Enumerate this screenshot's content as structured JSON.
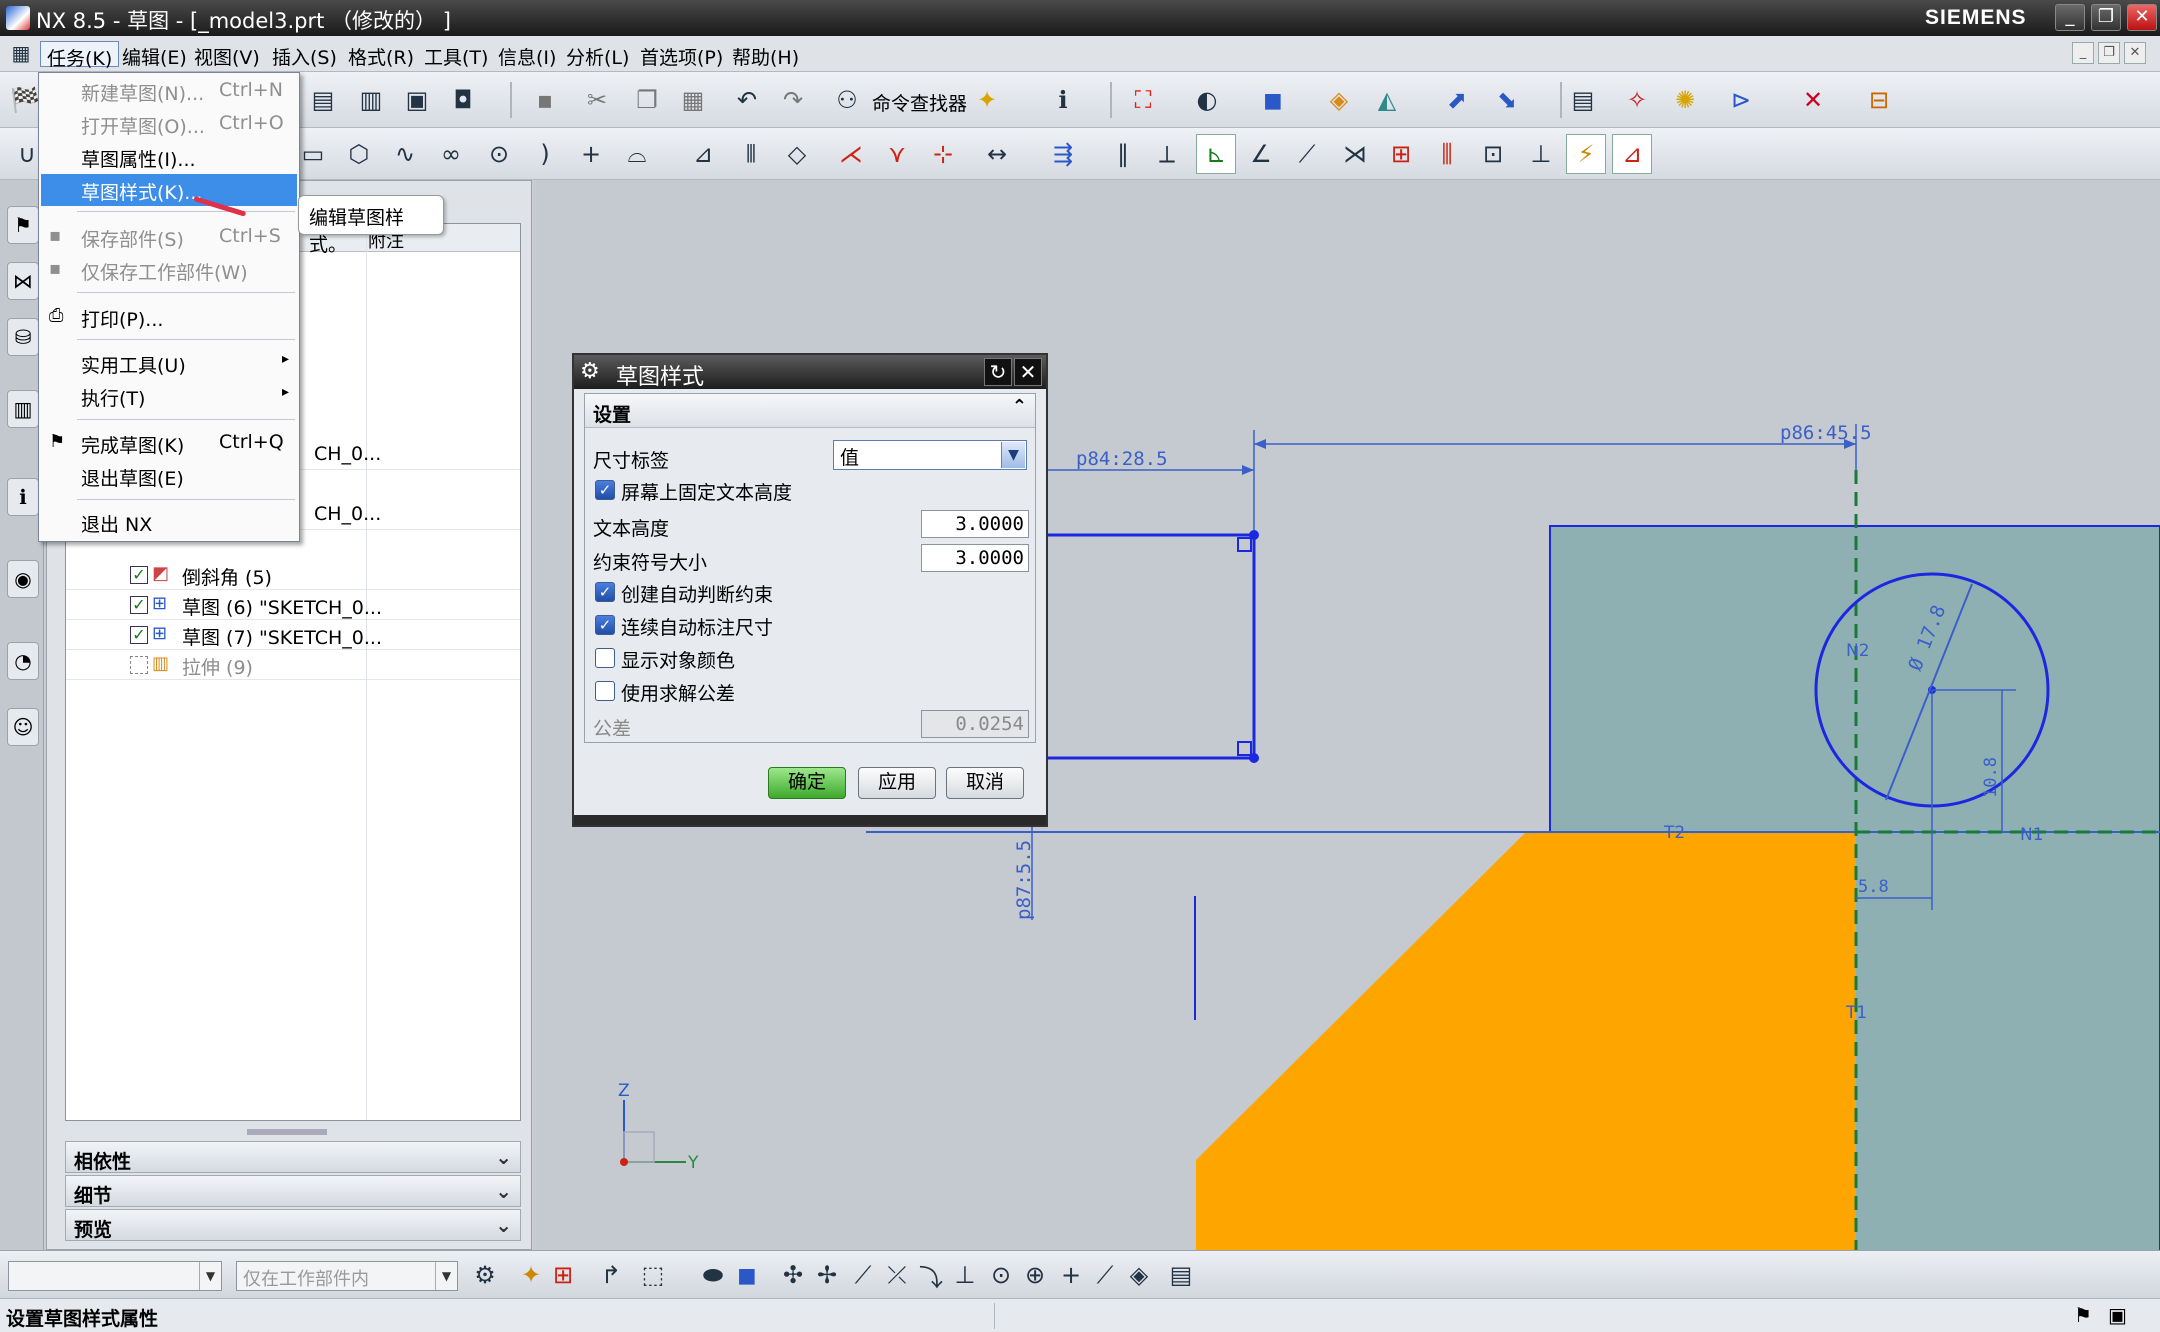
{
  "window": {
    "title": "NX 8.5 - 草图 - [_model3.prt （修改的） ]",
    "brand": "SIEMENS",
    "controls": [
      "_",
      "❐",
      "✕"
    ]
  },
  "menubar": {
    "items": [
      "任务(K)",
      "编辑(E)",
      "视图(V)",
      "插入(S)",
      "格式(R)",
      "工具(T)",
      "信息(I)",
      "分析(L)",
      "首选项(P)",
      "帮助(H)"
    ],
    "active_index": 0,
    "mdi": [
      "_",
      "❐",
      "✕"
    ]
  },
  "toolbar": {
    "command_finder": "命令查找器"
  },
  "task_menu": {
    "items": [
      {
        "label": "新建草图(N)...",
        "shortcut": "Ctrl+N",
        "disabled": true
      },
      {
        "label": "打开草图(O)...",
        "shortcut": "Ctrl+O",
        "disabled": true
      },
      {
        "label": "草图属性(I)..."
      },
      {
        "label": "草图样式(K)..."
      },
      {
        "label": "保存部件(S)",
        "shortcut": "Ctrl+S",
        "disabled": true
      },
      {
        "label": "仅保存工作部件(W)",
        "disabled": true
      },
      {
        "label": "打印(P)..."
      },
      {
        "label": "实用工具(U)",
        "submenu": "▸"
      },
      {
        "label": "执行(T)",
        "submenu": "▸"
      },
      {
        "label": "完成草图(K)",
        "shortcut": "Ctrl+Q"
      },
      {
        "label": "退出草图(E)"
      },
      {
        "label": "退出 NX"
      }
    ]
  },
  "tooltip": {
    "text": "编辑草图样式。"
  },
  "navigator": {
    "col_header": "附注",
    "partial_rows": [
      "CH_0...",
      "CH_0..."
    ],
    "rows": [
      {
        "label": "倒斜角 (5)"
      },
      {
        "label": "草图 (6) \"SKETCH_0..."
      },
      {
        "label": "草图 (7) \"SKETCH_0..."
      },
      {
        "label": "拉伸 (9)"
      }
    ],
    "sections": [
      "相依性",
      "细节",
      "预览"
    ]
  },
  "dialog": {
    "title": "草图样式",
    "group": "设置",
    "dim_label": {
      "label": "尺寸标签",
      "value": "值"
    },
    "fix_text_height": {
      "label": "屏幕上固定文本高度",
      "checked": true
    },
    "text_height": {
      "label": "文本高度",
      "value": "3.0000"
    },
    "constraint_symbol_size": {
      "label": "约束符号大小",
      "value": "3.0000"
    },
    "create_inferred": {
      "label": "创建自动判断约束",
      "checked": true
    },
    "continuous_dim": {
      "label": "连续自动标注尺寸",
      "checked": true
    },
    "show_object_color": {
      "label": "显示对象颜色",
      "checked": false
    },
    "use_solve_tolerance": {
      "label": "使用求解公差",
      "checked": false
    },
    "tolerance": {
      "label": "公差",
      "value": "0.0254"
    },
    "buttons": {
      "ok": "确定",
      "apply": "应用",
      "cancel": "取消"
    }
  },
  "graphics": {
    "dims": {
      "p84": "p84:28.5",
      "p86": "p86:45.5",
      "p87": "p87:5.5",
      "diameter": "Ø 17.8",
      "d108": "10.8",
      "d58": "5.8"
    },
    "labels": {
      "n1": "N1",
      "n2": "N2",
      "t1": "T1",
      "t2": "T2"
    },
    "axes": {
      "z": "Z",
      "y": "Y"
    }
  },
  "bottombar": {
    "filter_placeholder": "仅在工作部件内"
  },
  "status": {
    "text": "设置草图样式属性"
  },
  "colors": {
    "sketch_blue": "#1c27e0",
    "dim_blue": "#3b5fc8",
    "solid_orange": "#ffa500",
    "face_teal": "#8fb0b3",
    "highlight": "#3d8ee8",
    "ok_green": "#3da92c"
  }
}
